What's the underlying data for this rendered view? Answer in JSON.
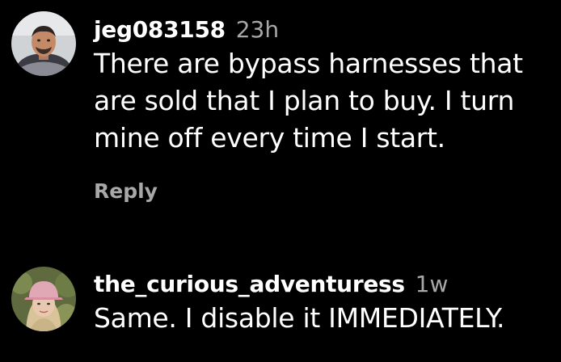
{
  "comments": [
    {
      "username": "jeg083158",
      "time": "23h",
      "text": "There are bypass harnesses that are sold that I plan to buy. I turn mine off every time I start.",
      "reply_label": "Reply"
    },
    {
      "username": "the_curious_adventuress",
      "time": "1w",
      "text": "Same. I disable it IMMEDIATELY."
    }
  ],
  "colors": {
    "background": "#000000",
    "primary_text": "#ffffff",
    "secondary_text": "#a8a8a8"
  }
}
